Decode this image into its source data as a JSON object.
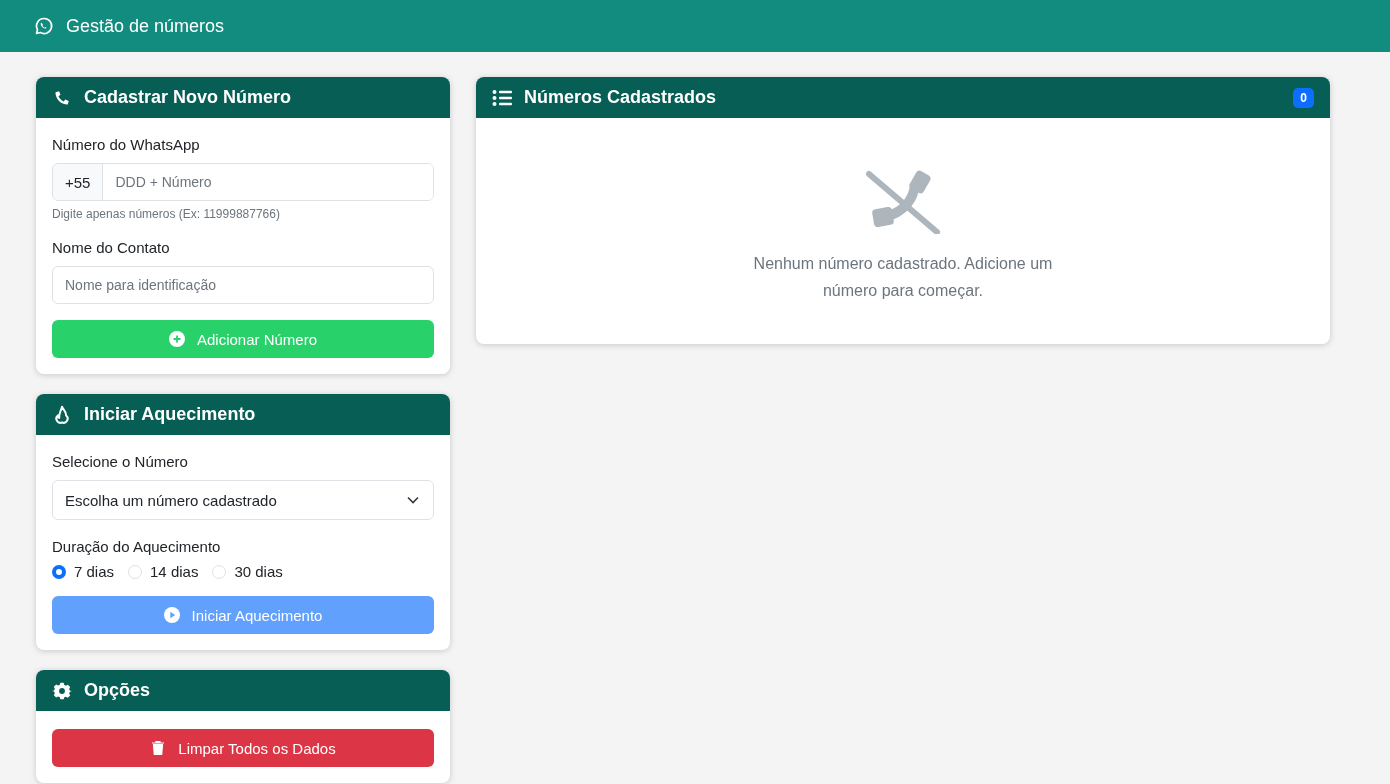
{
  "navbar": {
    "title": "Gestão de números"
  },
  "register_card": {
    "title": "Cadastrar Novo Número",
    "phone_label": "Número do WhatsApp",
    "prefix": "+55",
    "phone_placeholder": "DDD + Número",
    "phone_help": "Digite apenas números (Ex: 11999887766)",
    "name_label": "Nome do Contato",
    "name_placeholder": "Nome para identificação",
    "button": "Adicionar Número"
  },
  "warmup_card": {
    "title": "Iniciar Aquecimento",
    "select_label": "Selecione o Número",
    "select_value": "Escolha um número cadastrado",
    "duration_label": "Duração do Aquecimento",
    "durations": [
      {
        "label": "7 dias",
        "selected": true
      },
      {
        "label": "14 dias",
        "selected": false
      },
      {
        "label": "30 dias",
        "selected": false
      }
    ],
    "button": "Iniciar Aquecimento",
    "button_disabled": true
  },
  "options_card": {
    "title": "Opções",
    "button": "Limpar Todos os Dados"
  },
  "numbers_card": {
    "title": "Números Cadastrados",
    "count": "0",
    "empty_message": "Nenhum número cadastrado. Adicione um número para começar."
  }
}
